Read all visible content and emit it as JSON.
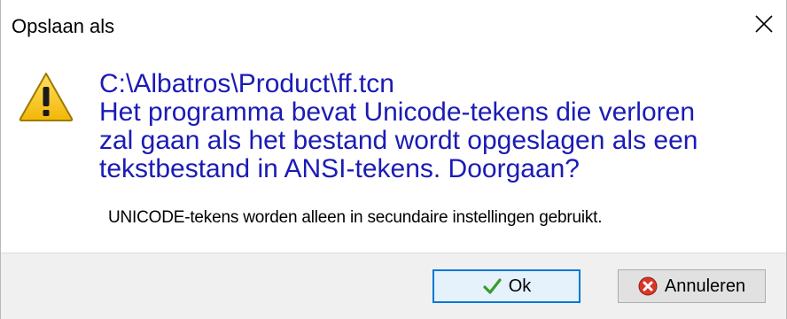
{
  "window": {
    "title": "Opslaan als",
    "close_icon": "close-icon"
  },
  "icon": "warning-triangle-icon",
  "message": {
    "path": "C:\\Albatros\\Product\\ff.tcn",
    "lines": [
      "Het programma bevat Unicode-tekens die verloren",
      "zal gaan als het bestand wordt opgeslagen als een",
      "tekstbestand in ANSI-tekens. Doorgaan?"
    ],
    "color": "#1b1bb5"
  },
  "submessage": "UNICODE-tekens worden alleen in secundaire instellingen gebruikt.",
  "buttons": {
    "ok": {
      "label": "Ok",
      "icon": "checkmark-icon"
    },
    "cancel": {
      "label": "Annuleren",
      "icon": "cancel-x-icon"
    }
  },
  "colors": {
    "accent": "#0078d7",
    "footer": "#f0f0f0"
  }
}
